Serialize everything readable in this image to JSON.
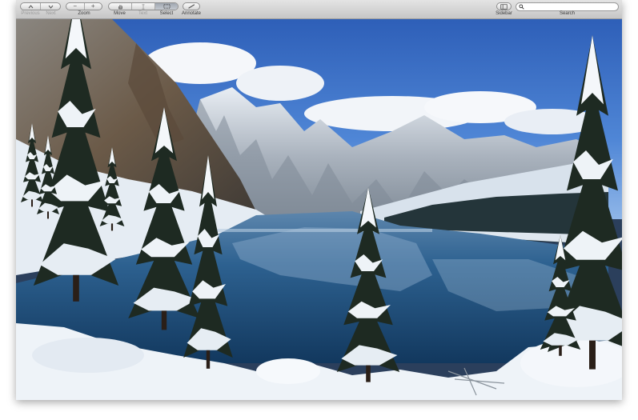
{
  "toolbar": {
    "previous_label": "Previous",
    "next_label": "Next",
    "zoom_label": "Zoom",
    "zoom_out_glyph": "−",
    "zoom_in_glyph": "+",
    "move_label": "Move",
    "text_label": "Text",
    "select_label": "Select",
    "annotate_label": "Annotate",
    "sidebar_label": "Sidebar",
    "search_label": "Search"
  },
  "search": {
    "placeholder": ""
  },
  "icons": {
    "previous": "chevron-up-icon",
    "next": "chevron-down-icon",
    "move": "hand-icon",
    "text": "text-cursor-icon",
    "select": "marquee-select-icon",
    "annotate": "pencil-icon",
    "sidebar": "sidebar-icon",
    "search": "magnifier-icon"
  },
  "document": {
    "image_subject": "snowy mountain lake with evergreen trees"
  },
  "colors": {
    "toolbar_top": "#e4e4e4",
    "toolbar_bottom": "#c6c6c6",
    "sky": "#3d6fc4",
    "lake": "#1e4f7e",
    "snow": "#eef3f8"
  }
}
